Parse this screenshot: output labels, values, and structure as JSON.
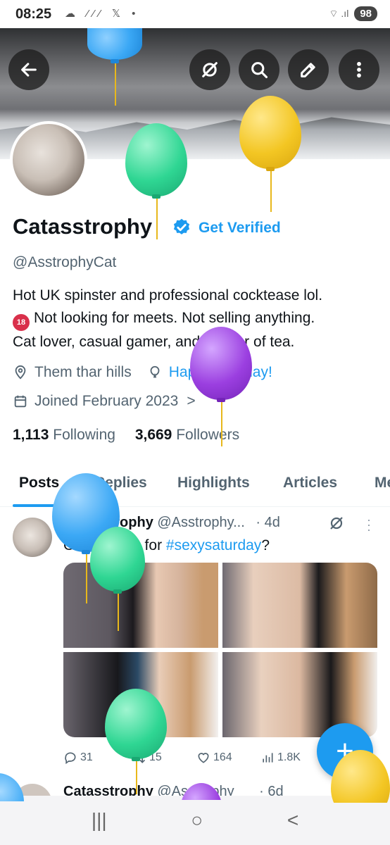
{
  "status_bar": {
    "time": "08:25",
    "icons": "☁ ⁄⁄⁄ 𝕏 •",
    "signal": "⌔ .ıl",
    "battery": "98"
  },
  "profile": {
    "name": "Catasstrophy",
    "get_verified": "Get Verified",
    "handle": "@AsstrophyCat",
    "bio_line1": "Hot UK spinster and professional cocktease lol.",
    "bio_badge": "18",
    "bio_line2": "Not looking for meets. Not selling anything.",
    "bio_line3": "Cat lover, casual gamer, and drinker of tea.",
    "location": "Them thar hills",
    "birthday": "Happy birthday!",
    "joined": "Joined February 2023",
    "joined_chevron": ">",
    "following_count": "1,113",
    "following_label": "Following",
    "followers_count": "3,669",
    "followers_label": "Followers"
  },
  "tabs": [
    "Posts",
    "Replies",
    "Highlights",
    "Articles",
    "Me"
  ],
  "post": {
    "name": "Catasstrophy",
    "handle": "@Asstrophy...",
    "time": "· 4d",
    "text": "Outfit 1 or 2 for ",
    "hashtag": "#sexysaturday",
    "text_end": "?",
    "replies": "31",
    "reposts": "15",
    "likes": "164",
    "views": "1.8K"
  },
  "post2": {
    "name": "Catasstrophy",
    "handle": "@Asstrophy",
    "time": "· 6d"
  },
  "fab": {
    "label": "+"
  },
  "navbar": {
    "recent": "|||",
    "home": "○",
    "back": "<"
  },
  "colors": {
    "accent": "#1d9bf0",
    "balloon_blue": "#3ba8f5",
    "balloon_green": "#2fd693",
    "balloon_yellow": "#f3c623",
    "balloon_purple": "#9b3fe0"
  }
}
